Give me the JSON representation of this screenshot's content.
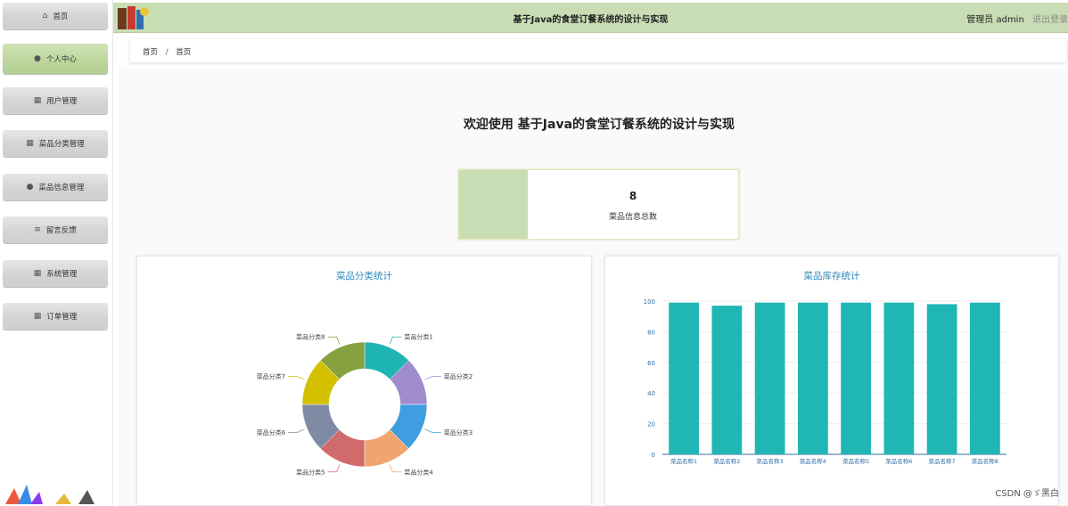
{
  "sidebar": {
    "items": [
      {
        "label": "首页",
        "icon": "home-icon",
        "glyph": "⌂"
      },
      {
        "label": "个人中心",
        "icon": "user-icon",
        "glyph": "👤"
      },
      {
        "label": "用户管理",
        "icon": "grid-icon",
        "glyph": "▪"
      },
      {
        "label": "菜品分类管理",
        "icon": "grid-icon",
        "glyph": "▪"
      },
      {
        "label": "菜品信息管理",
        "icon": "pin-icon",
        "glyph": "●"
      },
      {
        "label": "留言反馈",
        "icon": "sliders-icon",
        "glyph": "≡"
      },
      {
        "label": "系统管理",
        "icon": "grid-icon",
        "glyph": "▪"
      },
      {
        "label": "订单管理",
        "icon": "table-icon",
        "glyph": "▦"
      }
    ]
  },
  "header": {
    "title": "基于Java的食堂订餐系统的设计与实现",
    "role": "管理员",
    "username": "admin",
    "logout": "退出登录"
  },
  "breadcrumb": {
    "home": "首页",
    "separator": "/",
    "current": "首页"
  },
  "welcome": "欢迎使用 基于Java的食堂订餐系统的设计与实现",
  "stat": {
    "value": "8",
    "label": "菜品信息总数"
  },
  "colors": {
    "accent": "#c8ddb3",
    "title": "#2d87b8",
    "bar": "#20b6b4"
  },
  "watermark": "CSDN @ゞ黑白",
  "chart_data": [
    {
      "type": "pie",
      "title": "菜品分类统计",
      "donut": true,
      "categories": [
        "菜品分类1",
        "菜品分类2",
        "菜品分类3",
        "菜品分类4",
        "菜品分类5",
        "菜品分类6",
        "菜品分类7",
        "菜品分类8"
      ],
      "values": [
        1,
        1,
        1,
        1,
        1,
        1,
        1,
        1
      ],
      "colors": [
        "#1fb5b2",
        "#9e8ccc",
        "#3f9ee0",
        "#f0a56f",
        "#d16b6b",
        "#7f8aa5",
        "#d3c000",
        "#86a140"
      ]
    },
    {
      "type": "bar",
      "title": "菜品库存统计",
      "categories": [
        "菜品名称1",
        "菜品名称2",
        "菜品名称3",
        "菜品名称4",
        "菜品名称5",
        "菜品名称6",
        "菜品名称7",
        "菜品名称8"
      ],
      "values": [
        99,
        97,
        99,
        99,
        99,
        99,
        98,
        99
      ],
      "ylim": [
        0,
        100
      ],
      "yticks": [
        0,
        20,
        40,
        60,
        80,
        100
      ],
      "grid": true
    }
  ]
}
